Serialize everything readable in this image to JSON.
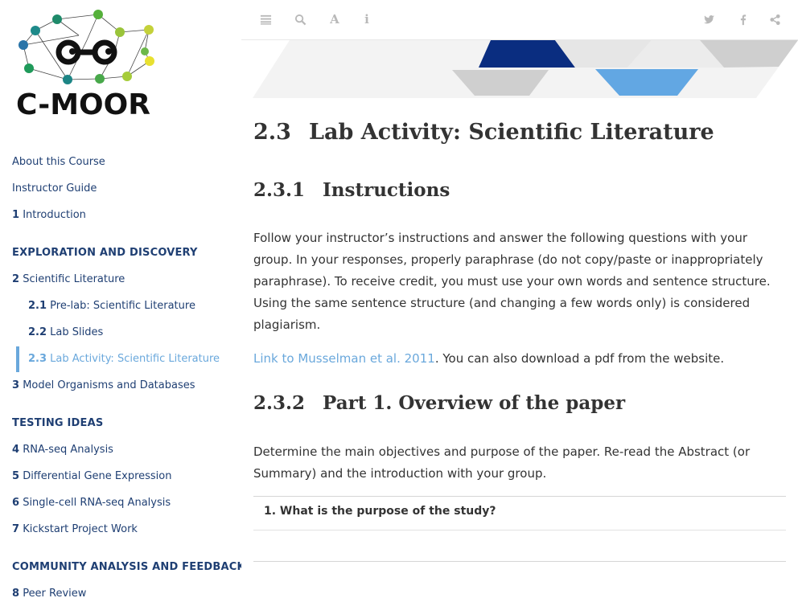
{
  "logo": {
    "text": "C-MOOR"
  },
  "toc": {
    "about": "About this Course",
    "instructor": "Instructor Guide",
    "ch1_num": "1",
    "ch1_label": "Introduction",
    "part1": "EXPLORATION AND DISCOVERY",
    "ch2_num": "2",
    "ch2_label": "Scientific Literature",
    "s21_num": "2.1",
    "s21_label": "Pre-lab: Scientific Literature",
    "s22_num": "2.2",
    "s22_label": "Lab Slides",
    "s23_num": "2.3",
    "s23_label": "Lab Activity: Scientific Literature",
    "ch3_num": "3",
    "ch3_label": "Model Organisms and Databases",
    "part2": "TESTING IDEAS",
    "ch4_num": "4",
    "ch4_label": "RNA-seq Analysis",
    "ch5_num": "5",
    "ch5_label": "Differential Gene Expression",
    "ch6_num": "6",
    "ch6_label": "Single-cell RNA-seq Analysis",
    "ch7_num": "7",
    "ch7_label": "Kickstart Project Work",
    "part3": "COMMUNITY ANALYSIS AND FEEDBACK",
    "ch8_num": "8",
    "ch8_label": "Peer Review"
  },
  "toolbar": {
    "icons": [
      "menu-icon",
      "search-icon",
      "font-icon",
      "info-icon",
      "twitter-icon",
      "facebook-icon",
      "share-icon"
    ],
    "font_glyph": "A",
    "info_glyph": "i"
  },
  "content": {
    "h1_num": "2.3",
    "h1_title": "Lab Activity: Scientific Literature",
    "h2a_num": "2.3.1",
    "h2a_title": "Instructions",
    "instructions": "Follow your instructor’s instructions and answer the following questions with your group. In your responses, properly paraphrase (do not copy/paste or inappropriately paraphrase). To receive credit, you must use your own words and sentence structure. Using the same sentence structure (and changing a few words only) is considered plagiarism.",
    "link_text": "Link to Musselman et al. 2011",
    "link_suffix": ". You can also download a pdf from the website.",
    "h2b_num": "2.3.2",
    "h2b_title": "Part 1. Overview of the paper",
    "part1_text": "Determine the main objectives and purpose of the paper. Re-read the Abstract (or Summary) and the introduction with your group.",
    "question1": "1. What is the purpose of the study?"
  },
  "colors": {
    "nav_text": "#1f3f73",
    "active_accent": "#6aa8dc",
    "banner_navy": "#0a2d80",
    "banner_blue": "#62a7e3",
    "banner_grey": "#cfcfcf"
  }
}
